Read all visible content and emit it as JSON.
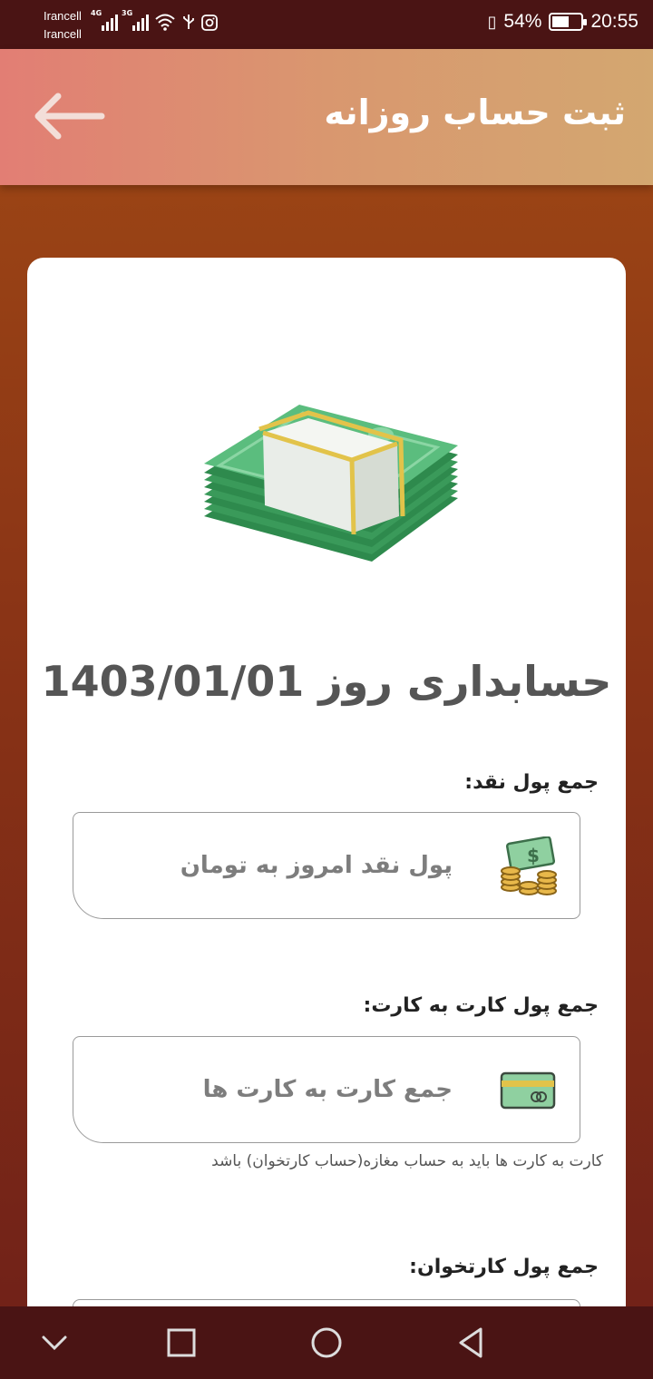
{
  "status_bar": {
    "carrier_1": "Irancell",
    "carrier_2": "Irancell",
    "network_1": "4G",
    "network_2": "3G",
    "battery": "54%",
    "time": "20:55"
  },
  "app_bar": {
    "title": "ثبت حساب روزانه",
    "back_icon": "arrow-left-icon"
  },
  "card": {
    "illustration": "money-stack-icon",
    "heading": "حسابداری روز  1403/01/01"
  },
  "fields": {
    "cash": {
      "label": "جمع پول نقد:",
      "placeholder": "پول نقد امروز به تومان",
      "icon": "cash-coins-icon"
    },
    "card_to_card": {
      "label": "جمع پول کارت به کارت:",
      "placeholder": "جمع کارت به کارت ها",
      "icon": "credit-card-icon",
      "helper": "کارت به کارت ها باید به حساب مغازه(حساب کارتخوان) باشد"
    },
    "pos": {
      "label": "جمع پول کارتخوان:"
    }
  },
  "nav_bar": {
    "icons": [
      "chevron-down-icon",
      "recents-square-icon",
      "home-circle-icon",
      "back-triangle-icon"
    ]
  },
  "colors": {
    "app_bar_start": "#e27e74",
    "app_bar_end": "#d3a770",
    "background": "#8a3416",
    "status_bar": "#4a1414"
  }
}
